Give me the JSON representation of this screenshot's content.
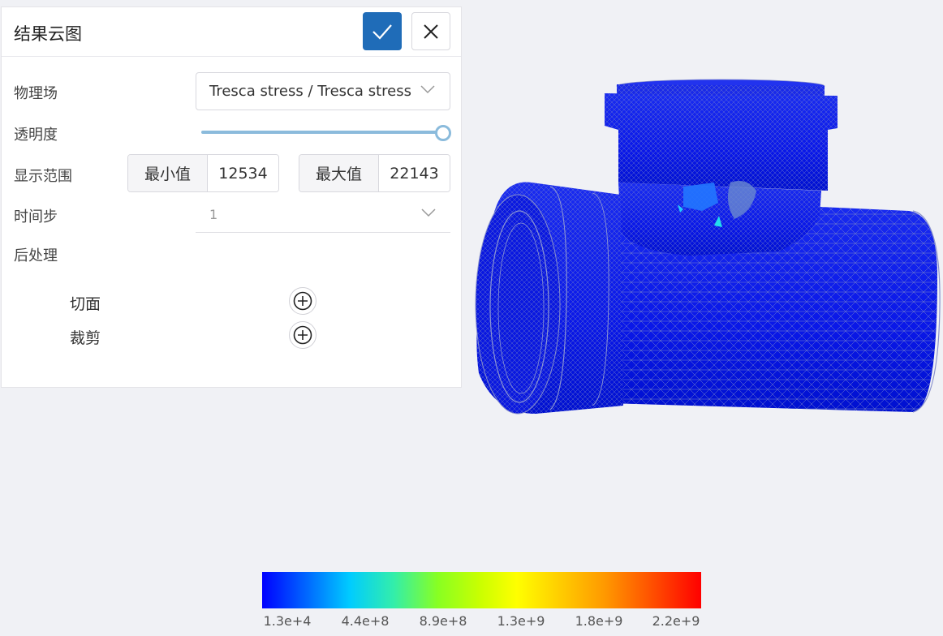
{
  "panel": {
    "title": "结果云图",
    "confirm_icon": "check-icon",
    "close_icon": "close-icon",
    "field_label": "物理场",
    "field_value": "Tresca stress / Tresca stress",
    "opacity_label": "透明度",
    "opacity_value": 1.0,
    "range_label": "显示范围",
    "min_label": "最小值",
    "min_value": "12534",
    "max_label": "最大值",
    "max_value": "22143",
    "timestep_label": "时间步",
    "timestep_value": "1",
    "postprocess_label": "后处理",
    "post_items": [
      {
        "label": "切面",
        "icon": "plus-circle-icon"
      },
      {
        "label": "裁剪",
        "icon": "plus-circle-icon"
      }
    ],
    "accent_color": "#1f6cb8",
    "slider_color": "#8bbbdc"
  },
  "legend": {
    "ticks": [
      "1.3e+4",
      "4.4e+8",
      "8.9e+8",
      "1.3e+9",
      "1.8e+9",
      "2.2e+9"
    ],
    "colors": [
      "#0000ff",
      "#00ccff",
      "#88ff22",
      "#ffff00",
      "#ff9900",
      "#ff0000"
    ]
  }
}
